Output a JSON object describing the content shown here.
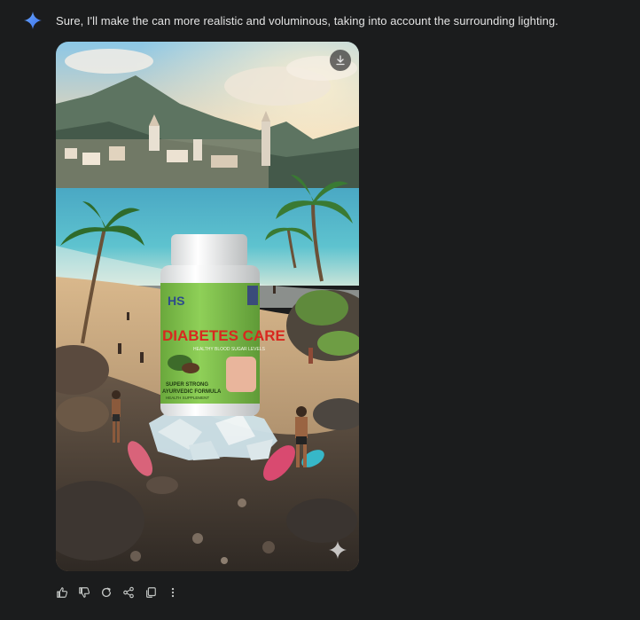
{
  "message": {
    "text": "Sure, I'll make the can more realistic and voluminous, taking into account the surrounding lighting."
  },
  "image": {
    "product_brand": "HS",
    "product_name": "DIABETES CARE",
    "product_tagline": "HEALTHY BLOOD SUGAR LEVELS",
    "product_line1": "SUPER STRONG",
    "product_line2": "AYURVEDIC FORMULA",
    "product_footer": "HEALTH SUPPLEMENT",
    "icons": [
      "download-icon",
      "sparkle-icon"
    ]
  },
  "actions": {
    "icons": [
      "thumbs-up-icon",
      "thumbs-down-icon",
      "redo-icon",
      "share-icon",
      "copy-icon",
      "more-vert-icon"
    ]
  },
  "colors": {
    "background": "#1b1c1d",
    "text": "#e3e3e3",
    "gemini_blue": "#4c8df6",
    "label_green": "#7cc04a",
    "label_red": "#d8281f"
  }
}
